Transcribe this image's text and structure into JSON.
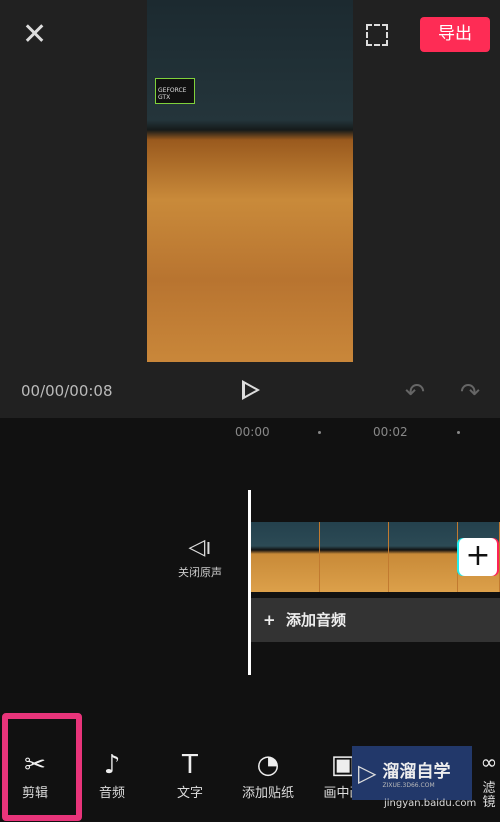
{
  "header": {
    "export_label": "导出"
  },
  "preview": {
    "sticker_text": "GEFORCE GTX",
    "time": "00/00/00:08"
  },
  "timeline": {
    "ticks": [
      "00:00",
      "00:02"
    ],
    "mute_label": "关闭原声",
    "add_audio_label": "添加音频",
    "add_clip": "+"
  },
  "toolbar": {
    "items": [
      {
        "label": "剪辑",
        "icon": "scissors-icon"
      },
      {
        "label": "音频",
        "icon": "music-note-icon"
      },
      {
        "label": "文字",
        "icon": "text-icon"
      },
      {
        "label": "添加贴纸",
        "icon": "sticker-icon"
      },
      {
        "label": "画中画",
        "icon": "pip-icon"
      },
      {
        "label": "滤镜",
        "icon": "filter-icon"
      }
    ]
  },
  "watermark": {
    "title": "溜溜自学",
    "sub": "ZIXUE.3D66.COM",
    "url": "jingyan.baidu.com"
  },
  "colors": {
    "accent": "#fe2c55",
    "highlight": "#e8347a"
  }
}
